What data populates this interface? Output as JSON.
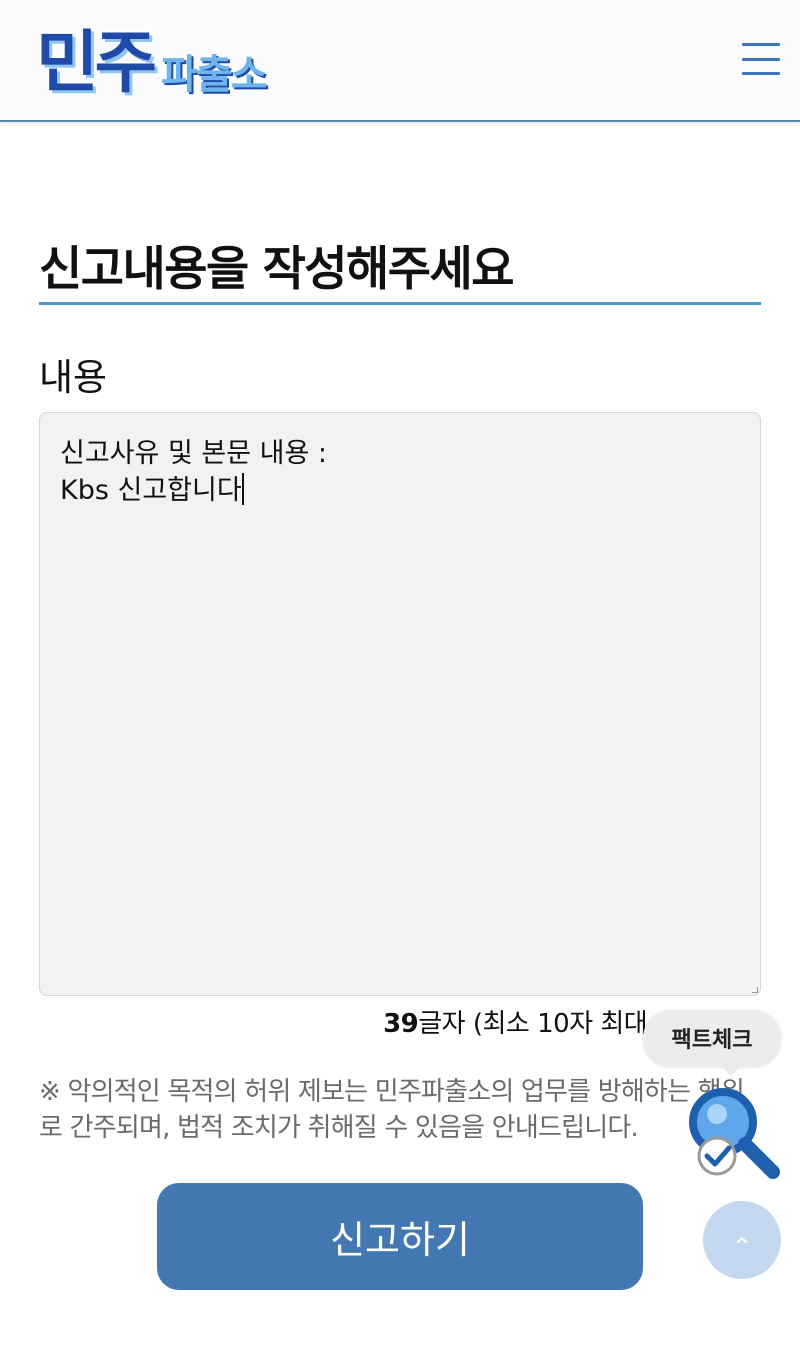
{
  "header": {
    "logo_primary": "민주",
    "logo_secondary": "파출소",
    "menu_icon": "hamburger-menu-icon"
  },
  "form": {
    "title": "신고내용을 작성해주세요",
    "content_label": "내용",
    "content_value": "신고사유 및 본문 내용 :\nKbs 신고합니다",
    "char_count": "39",
    "char_limit_text": "글자 (최소 10자 최대 1,000자)",
    "notice": "※ 악의적인 목적의 허위 제보는 민주파출소의 업무를 방해하는 행위로 간주되며, 법적 조치가 취해질 수 있음을 안내드립니다.",
    "submit_label": "신고하기"
  },
  "floating": {
    "factcheck_label": "팩트체크",
    "factcheck_icon": "magnifier-check-icon",
    "top_icon": "chevron-up-icon"
  },
  "colors": {
    "brand_blue": "#1f4aa8",
    "accent_line": "#4b9ad0",
    "submit_bg": "#4378b3",
    "top_btn_bg": "#c3d8ee"
  }
}
